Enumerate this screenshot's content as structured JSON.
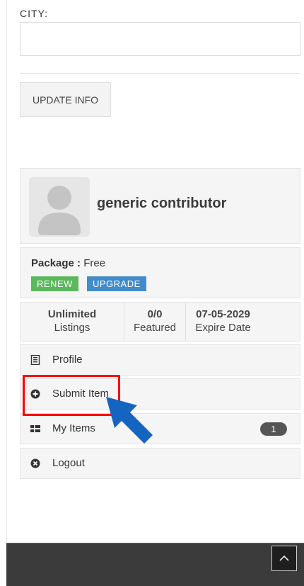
{
  "form": {
    "city_label": "CITY:",
    "city_value": "",
    "update_button": "UPDATE INFO"
  },
  "profile": {
    "name": "generic contributor"
  },
  "package": {
    "label": "Package :",
    "value": "Free",
    "renew_button": "RENEW",
    "upgrade_button": "UPGRADE",
    "renew_color": "#5cb85c",
    "upgrade_color": "#428bca"
  },
  "stats": [
    {
      "value": "Unlimited",
      "label": "Listings"
    },
    {
      "value": "0/0",
      "label": "Featured"
    },
    {
      "value": "07-05-2029",
      "label": "Expire Date"
    }
  ],
  "menu": [
    {
      "label": "Profile",
      "icon": "profile-card-icon"
    },
    {
      "label": "Submit Item",
      "icon": "plus-circle-icon"
    },
    {
      "label": "My Items",
      "icon": "list-icon",
      "badge": "1"
    },
    {
      "label": "Logout",
      "icon": "close-circle-icon"
    }
  ],
  "annotation": {
    "highlight_color": "#ff0000",
    "arrow_color": "#1565c0"
  },
  "footer": {
    "scroll_top_icon": "chevron-up-icon"
  }
}
